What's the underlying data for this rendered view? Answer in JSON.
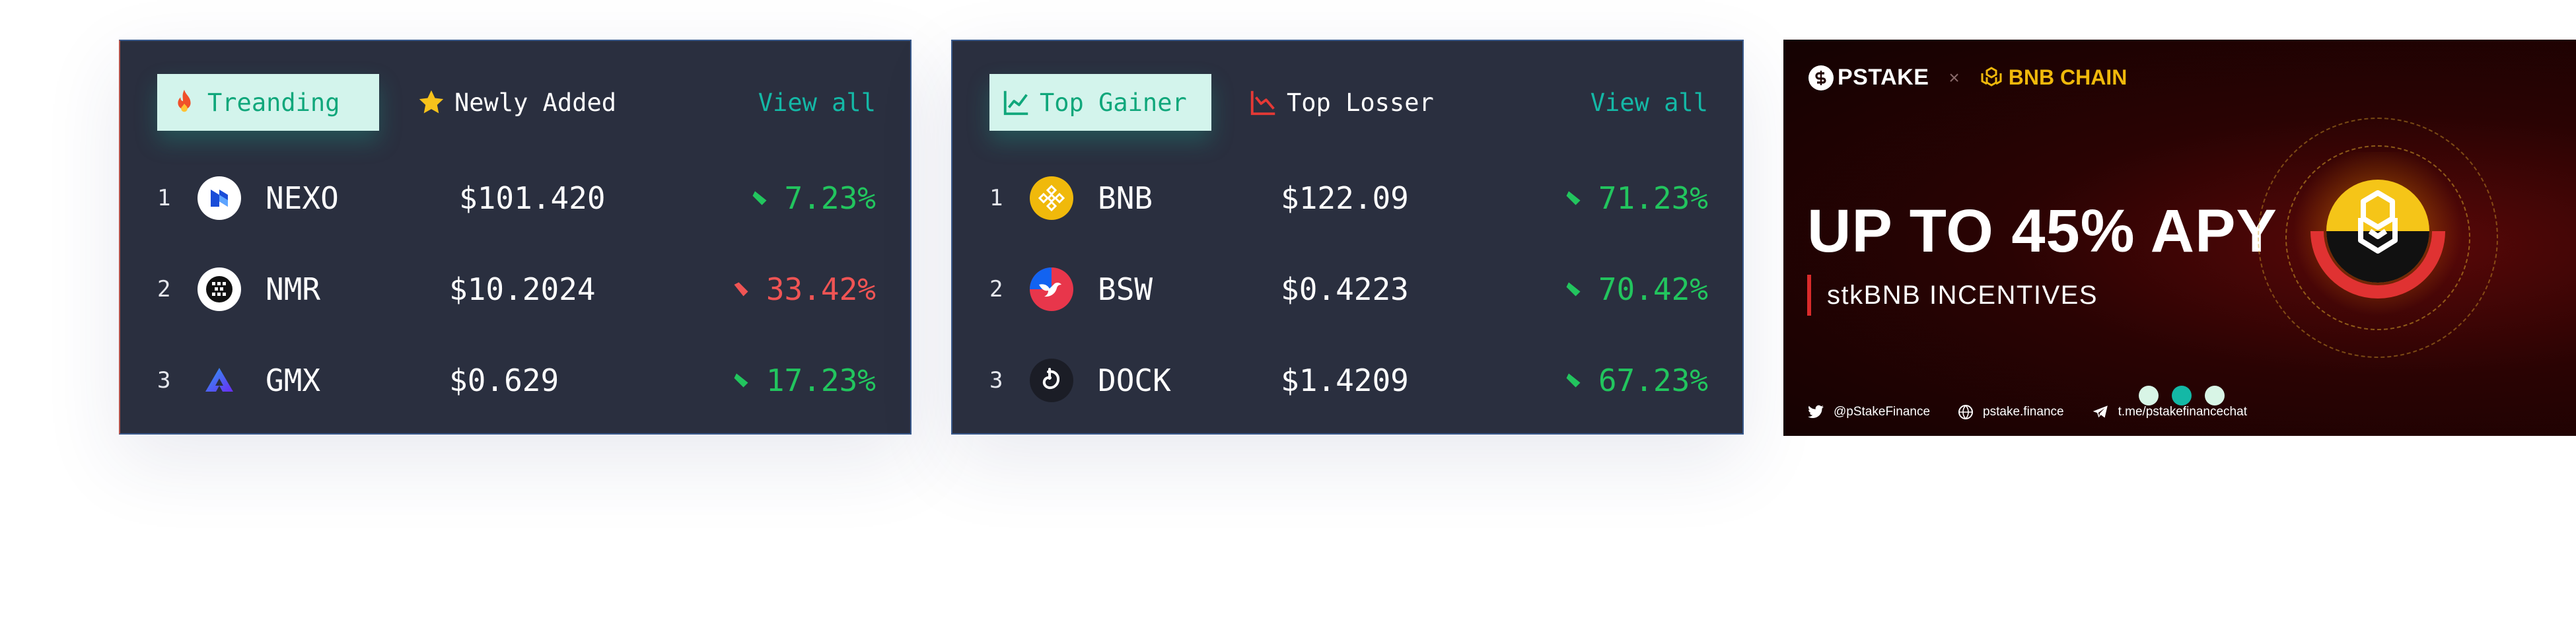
{
  "trending_card": {
    "tabs": [
      {
        "label": "Treanding",
        "icon": "fire-icon",
        "active": true
      },
      {
        "label": "Newly Added",
        "icon": "star-icon",
        "active": false
      }
    ],
    "view_all": "View all",
    "rows": [
      {
        "rank": "1",
        "symbol": "NEXO",
        "price": "$101.420",
        "change": "7.23%",
        "direction": "up",
        "icon": "nexo-logo-icon"
      },
      {
        "rank": "2",
        "symbol": "NMR",
        "price": "$10.2024",
        "change": "33.42%",
        "direction": "down",
        "icon": "numeraire-logo-icon"
      },
      {
        "rank": "3",
        "symbol": "GMX",
        "price": "$0.629",
        "change": "17.23%",
        "direction": "up",
        "icon": "gmx-logo-icon"
      }
    ]
  },
  "gainers_card": {
    "tabs": [
      {
        "label": "Top Gainer",
        "icon": "chart-up-icon",
        "active": true
      },
      {
        "label": "Top Losser",
        "icon": "chart-down-icon",
        "active": false
      }
    ],
    "view_all": "View all",
    "rows": [
      {
        "rank": "1",
        "symbol": "BNB",
        "price": "$122.09",
        "change": "71.23%",
        "direction": "up",
        "icon": "bnb-logo-icon"
      },
      {
        "rank": "2",
        "symbol": "BSW",
        "price": "$0.4223",
        "change": "70.42%",
        "direction": "up",
        "icon": "biswap-logo-icon"
      },
      {
        "rank": "3",
        "symbol": "DOCK",
        "price": "$1.4209",
        "change": "67.23%",
        "direction": "up",
        "icon": "dock-logo-icon"
      }
    ]
  },
  "banner": {
    "brand": "PSTAKE",
    "separator": "×",
    "partner": "BNB CHAIN",
    "headline": "UP TO 45% APY",
    "subline": "stkBNB INCENTIVES",
    "socials": [
      {
        "icon": "twitter-icon",
        "text": "@pStakeFinance"
      },
      {
        "icon": "globe-icon",
        "text": "pstake.finance"
      },
      {
        "icon": "telegram-icon",
        "text": "t.me/pstakefinancechat"
      }
    ],
    "carousel_active_index": 1,
    "carousel_count": 3
  },
  "colors": {
    "card_bg": "#2a2f3f",
    "accent_teal": "#14b8a6",
    "up_green": "#22c55e",
    "down_red": "#f05454",
    "bnb_gold": "#f0b90b"
  }
}
